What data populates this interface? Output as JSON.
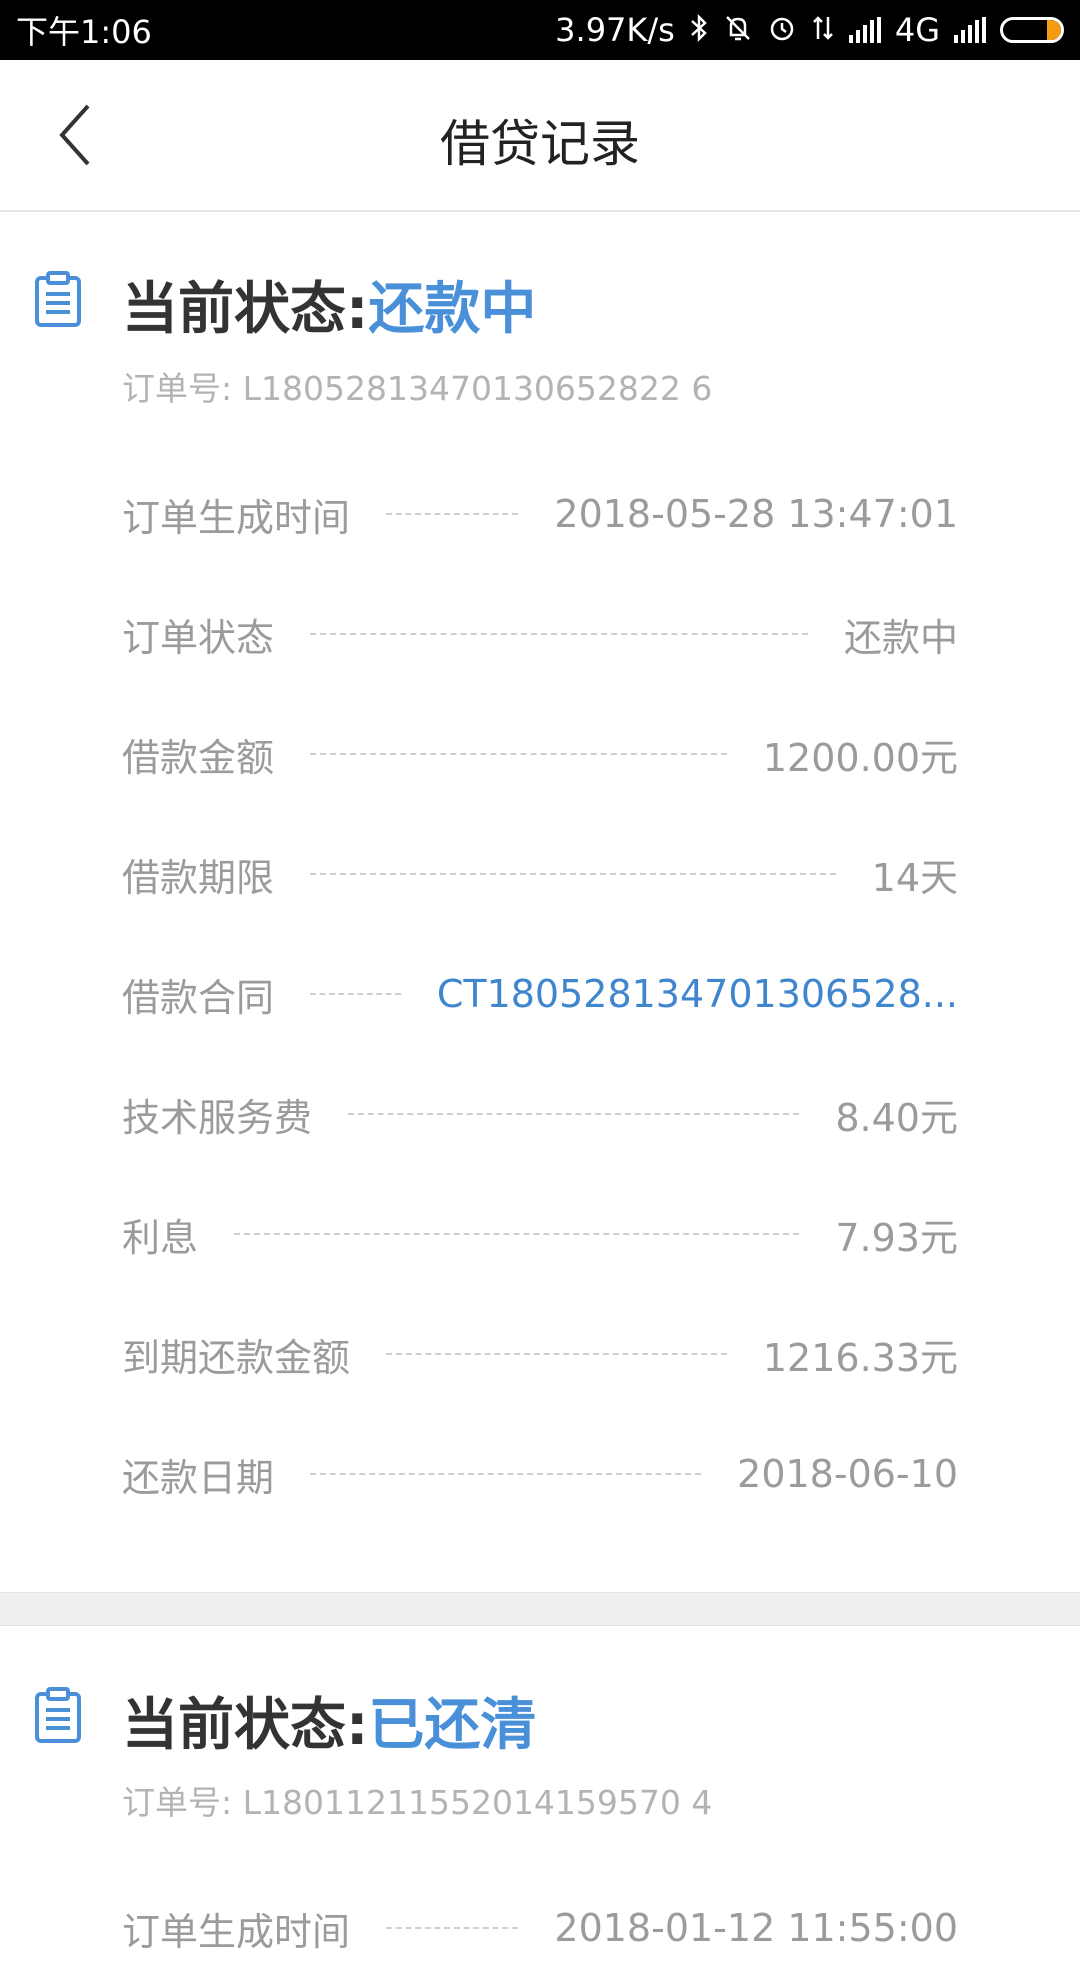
{
  "status_bar": {
    "time": "下午1:06",
    "net_speed": "3.97K/s",
    "network": "4G",
    "icons": [
      "bluetooth-icon",
      "mute-icon",
      "alarm-icon",
      "data-arrows-icon",
      "signal-icon",
      "signal-icon",
      "battery-icon"
    ],
    "battery_color": "#f39c12"
  },
  "nav": {
    "title": "借贷记录",
    "back_icon": "chevron-left-icon"
  },
  "colors": {
    "accent": "#4a90d9",
    "link": "#3f86cf",
    "label": "#9b9b9b",
    "separator": "#efefef"
  },
  "orders": [
    {
      "status_label": "当前状态:",
      "status_value": "还款中",
      "order_no": "订单号: L18052813470130652822 6",
      "rows": [
        {
          "label": "订单生成时间",
          "value": "2018-05-28 13:47:01"
        },
        {
          "label": "订单状态",
          "value": "还款中"
        },
        {
          "label": "借款金额",
          "value": "1200.00元"
        },
        {
          "label": "借款期限",
          "value": "14天"
        },
        {
          "label": "借款合同",
          "value": "CT180528134701306528..."
        },
        {
          "label": "技术服务费",
          "value": "8.40元"
        },
        {
          "label": "利息",
          "value": "7.93元"
        },
        {
          "label": "到期还款金额",
          "value": "1216.33元"
        },
        {
          "label": "还款日期",
          "value": "2018-06-10"
        }
      ]
    },
    {
      "status_label": "当前状态:",
      "status_value": "已还清",
      "order_no": "订单号: L18011211552014159570 4",
      "rows": [
        {
          "label": "订单生成时间",
          "value": "2018-01-12 11:55:00"
        }
      ]
    }
  ]
}
